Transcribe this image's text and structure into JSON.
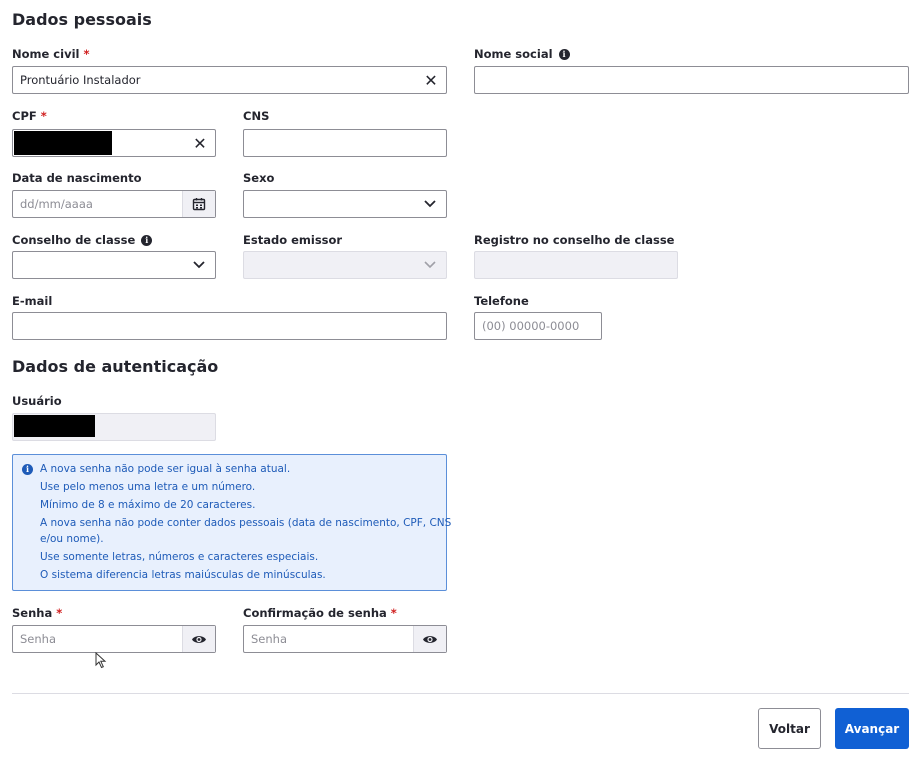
{
  "personal": {
    "title": "Dados pessoais",
    "nome_civil": {
      "label": "Nome civil",
      "required_mark": "*",
      "value": "Prontuário Instalador"
    },
    "nome_social": {
      "label": "Nome social",
      "value": ""
    },
    "cpf": {
      "label": "CPF",
      "required_mark": "*"
    },
    "cns": {
      "label": "CNS",
      "value": ""
    },
    "data_nascimento": {
      "label": "Data de nascimento",
      "placeholder": "dd/mm/aaaa"
    },
    "sexo": {
      "label": "Sexo",
      "value": ""
    },
    "conselho_classe": {
      "label": "Conselho de classe",
      "value": ""
    },
    "estado_emissor": {
      "label": "Estado emissor",
      "value": ""
    },
    "registro_conselho": {
      "label": "Registro no conselho de classe",
      "value": ""
    },
    "email": {
      "label": "E-mail",
      "value": ""
    },
    "telefone": {
      "label": "Telefone",
      "placeholder": "(00) 00000-0000"
    }
  },
  "auth": {
    "title": "Dados de autenticação",
    "usuario": {
      "label": "Usuário"
    },
    "rules": [
      "A nova senha não pode ser igual à senha atual.",
      "Use pelo menos uma letra e um número.",
      "Mínimo de 8 e máximo de 20 caracteres.",
      "A nova senha não pode conter dados pessoais (data de nascimento, CPF, CNS",
      "e/ou nome).",
      "Use somente letras, números e caracteres especiais.",
      "O sistema diferencia letras maiúsculas de minúsculas."
    ],
    "senha": {
      "label": "Senha",
      "required_mark": "*",
      "placeholder": "Senha"
    },
    "confirmacao": {
      "label": "Confirmação de senha",
      "required_mark": "*",
      "placeholder": "Senha"
    }
  },
  "footer": {
    "back_label": "Voltar",
    "next_label": "Avançar"
  },
  "colors": {
    "primary": "#1060d4",
    "required": "#d01e1e",
    "info_text": "#1e5bb8",
    "info_bg": "#e8f0fd"
  },
  "icons": [
    "clear-icon",
    "info-icon",
    "calendar-icon",
    "chevron-down-icon",
    "eye-icon",
    "mouse-cursor-icon"
  ]
}
